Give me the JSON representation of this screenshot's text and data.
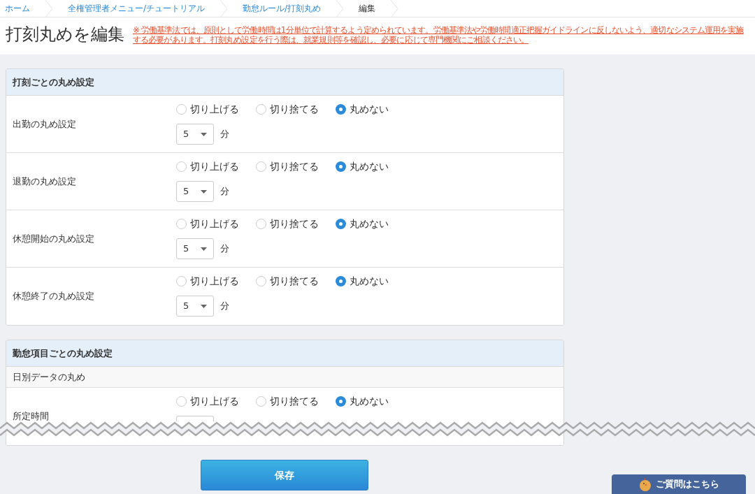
{
  "breadcrumbs": [
    {
      "label": "ホーム",
      "link": true
    },
    {
      "label": "全権管理者メニュー/チュートリアル",
      "link": true
    },
    {
      "label": "勤怠ルール/打刻丸め",
      "link": true
    },
    {
      "label": "編集",
      "link": false
    }
  ],
  "page_title": "打刻丸めを編集",
  "notice": "※ 労働基準法では、原則として労働時間は1分単位で計算するよう定められています。労働基準法や労働時間適正把握ガイドラインに反しないよう、適切なシステム運用を実施する必要があります。打刻丸め設定を行う際は、就業規則等を確認し、必要に応じて専門機関にご相談ください。",
  "sections": [
    {
      "title": "打刻ごとの丸め設定",
      "items": [
        {
          "kind": "setting",
          "label": "出勤の丸め設定",
          "options": [
            {
              "label": "切り上げる",
              "selected": false
            },
            {
              "label": "切り捨てる",
              "selected": false
            },
            {
              "label": "丸めない",
              "selected": true
            }
          ],
          "interval": "5",
          "unit": "分"
        },
        {
          "kind": "setting",
          "label": "退勤の丸め設定",
          "options": [
            {
              "label": "切り上げる",
              "selected": false
            },
            {
              "label": "切り捨てる",
              "selected": false
            },
            {
              "label": "丸めない",
              "selected": true
            }
          ],
          "interval": "5",
          "unit": "分"
        },
        {
          "kind": "setting",
          "label": "休憩開始の丸め設定",
          "options": [
            {
              "label": "切り上げる",
              "selected": false
            },
            {
              "label": "切り捨てる",
              "selected": false
            },
            {
              "label": "丸めない",
              "selected": true
            }
          ],
          "interval": "5",
          "unit": "分"
        },
        {
          "kind": "setting",
          "label": "休憩終了の丸め設定",
          "options": [
            {
              "label": "切り上げる",
              "selected": false
            },
            {
              "label": "切り捨てる",
              "selected": false
            },
            {
              "label": "丸めない",
              "selected": true
            }
          ],
          "interval": "5",
          "unit": "分"
        }
      ]
    },
    {
      "title": "勤怠項目ごとの丸め設定",
      "items": [
        {
          "kind": "subheading",
          "label": "日別データの丸め"
        },
        {
          "kind": "setting",
          "label": "所定時間",
          "options": [
            {
              "label": "切り上げる",
              "selected": false
            },
            {
              "label": "切り捨てる",
              "selected": false
            },
            {
              "label": "丸めない",
              "selected": true
            }
          ]
        }
      ]
    }
  ],
  "save_button": "保存",
  "help_button": "ご質問はこちら"
}
